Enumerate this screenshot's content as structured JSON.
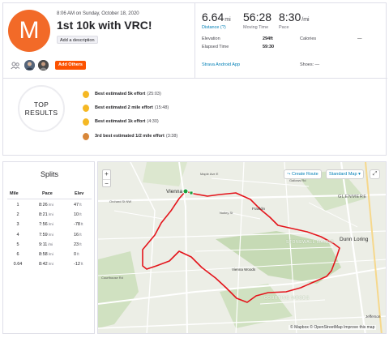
{
  "activity": {
    "avatar_letter": "M",
    "datetime": "8:06 AM on Sunday, October 18, 2020",
    "title": "1st 10k with VRC!",
    "add_description_label": "Add a description",
    "add_others_label": "Add Others"
  },
  "stats": {
    "distance": {
      "value": "6.64",
      "unit": "mi",
      "label": "Distance (?)"
    },
    "moving_time": {
      "value": "56:28",
      "label": "Moving Time"
    },
    "pace": {
      "value": "8:30",
      "unit": "/mi",
      "label": "Pace"
    },
    "elevation_label": "Elevation",
    "elevation_value": "294ft",
    "elapsed_label": "Elapsed Time",
    "elapsed_value": "59:30",
    "calories_label": "Calories",
    "calories_value": "—",
    "device": "Strava Android App",
    "shoes_label": "Shoes: —"
  },
  "top_results": {
    "badge_line1": "TOP",
    "badge_line2": "RESULTS",
    "items": [
      {
        "text": "Best estimated 5k effort",
        "time": "(25:03)",
        "medal": "gold"
      },
      {
        "text": "Best estimated 2 mile effort",
        "time": "(15:48)",
        "medal": "gold"
      },
      {
        "text": "Best estimated 1k effort",
        "time": "(4:30)",
        "medal": "gold"
      },
      {
        "text": "3rd best estimated 1/2 mile effort",
        "time": "(3:38)",
        "medal": "bronze"
      }
    ]
  },
  "splits": {
    "title": "Splits",
    "headers": {
      "mile": "Mile",
      "pace": "Pace",
      "elev": "Elev"
    },
    "pace_unit": "/mi",
    "elev_unit": "ft",
    "rows": [
      {
        "mile": "1",
        "pace": "8:26",
        "elev": "47"
      },
      {
        "mile": "2",
        "pace": "8:21",
        "elev": "10"
      },
      {
        "mile": "3",
        "pace": "7:56",
        "elev": "-78"
      },
      {
        "mile": "4",
        "pace": "7:59",
        "elev": "16"
      },
      {
        "mile": "5",
        "pace": "9:11",
        "elev": "23"
      },
      {
        "mile": "6",
        "pace": "8:58",
        "elev": "0"
      },
      {
        "mile": "0.64",
        "pace": "8:42",
        "elev": "-12"
      }
    ]
  },
  "map": {
    "zoom_in": "+",
    "zoom_out": "−",
    "create_route": "Create Route",
    "map_style": "Standard Map ▾",
    "places": {
      "vienna": "Vienna",
      "glenmere": "GLENMERE",
      "dunn_loring": "Dunn Loring",
      "stonewall_manor": "STONEWALL MANOR",
      "vienna_woods": "Vienna Woods",
      "courting_woods": "COURTING WOODS",
      "franklin": "Franklin",
      "jefferson": "Jefferson"
    },
    "streets": {
      "orchard": "Orchard St NW",
      "courthouse": "Courthouse Rd",
      "maple": "Maple Ave E",
      "nutley": "Nutley St",
      "gallows": "Gallows Rd"
    },
    "attribution": "© Mapbox © OpenStreetMap Improve this map",
    "colors": {
      "route": "#e4141b",
      "start": "#1a9e3a",
      "road": "#ffffff",
      "park": "#b9d3a4"
    }
  }
}
